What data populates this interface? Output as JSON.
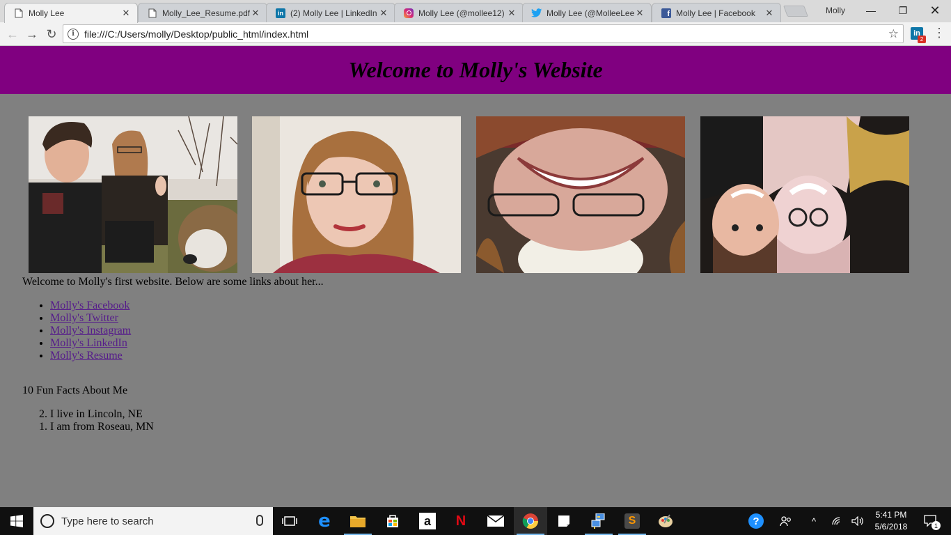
{
  "browser": {
    "tabs": [
      {
        "label": "Molly Lee",
        "icon": "page-icon",
        "active": true
      },
      {
        "label": "Molly_Lee_Resume.pdf",
        "icon": "page-icon"
      },
      {
        "label": "(2) Molly Lee | LinkedIn",
        "icon": "linkedin-icon"
      },
      {
        "label": "Molly Lee (@mollee12)",
        "icon": "instagram-icon"
      },
      {
        "label": "Molly Lee (@MolleeLee",
        "icon": "twitter-icon"
      },
      {
        "label": "Molly Lee | Facebook",
        "icon": "facebook-icon"
      }
    ],
    "profile_name": "Molly",
    "url": "file:///C:/Users/molly/Desktop/public_html/index.html",
    "extension_badge": "2",
    "extension_label": "in"
  },
  "page": {
    "title": "Welcome to Molly's Website",
    "intro": "Welcome to Molly's first website. Below are some links about her...",
    "links": [
      "Molly's Facebook",
      "Molly's Twitter",
      "Molly's Instagram",
      "Molly's LinkedIn",
      "Molly's Resume"
    ],
    "facts_title": "10 Fun Facts About Me",
    "facts": [
      {
        "num": "2.",
        "text": "I live in Lincoln, NE"
      },
      {
        "num": "1.",
        "text": "I am from Roseau, MN"
      }
    ],
    "photos": [
      "group-selfie-with-dog",
      "portrait-selfie",
      "upside-down-selfie",
      "upside-down-couple-selfie"
    ],
    "colors": {
      "header_bg": "#800080",
      "page_bg": "#808080",
      "link": "#551a8b"
    }
  },
  "taskbar": {
    "search_placeholder": "Type here to search",
    "time": "5:41 PM",
    "date": "5/6/2018",
    "notification_count": "1"
  }
}
